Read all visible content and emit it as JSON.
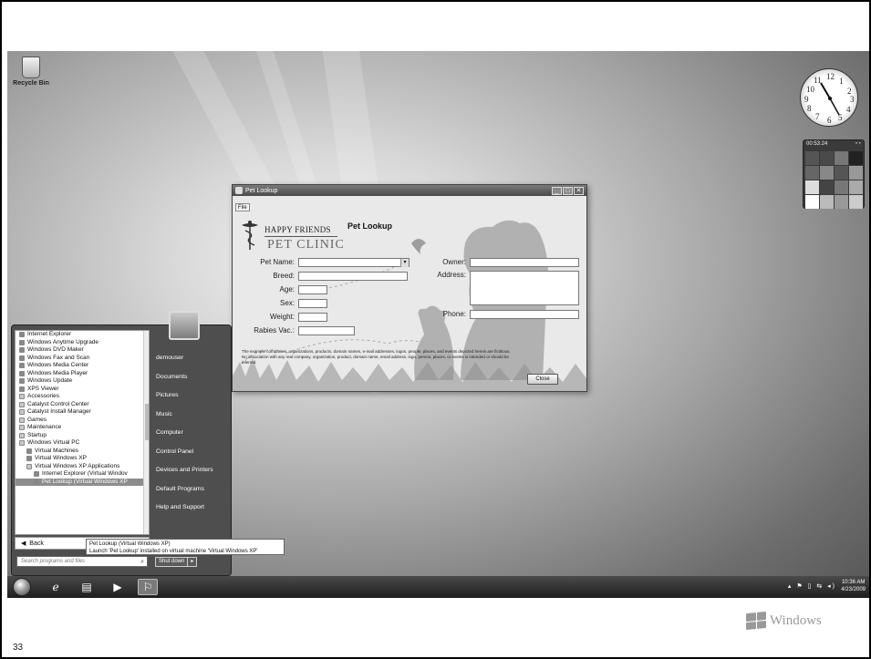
{
  "desktop": {
    "recycle_bin_label": "Recycle Bin",
    "clock_numbers": [
      "12",
      "1",
      "2",
      "3",
      "4",
      "5",
      "6",
      "7",
      "8",
      "9",
      "10",
      "11"
    ],
    "puzzle_timer": "00:53:24"
  },
  "window": {
    "title": "Pet Lookup",
    "menu_file": "File",
    "logo_line1": "HAPPY FRIENDS",
    "logo_line2": "PET CLINIC",
    "heading": "Pet Lookup",
    "labels": {
      "pet_name": "Pet Name:",
      "breed": "Breed:",
      "age": "Age:",
      "sex": "Sex:",
      "weight": "Weight:",
      "rabies": "Rabies Vac.:",
      "owner": "Owner:",
      "address": "Address:",
      "phone": "Phone:"
    },
    "disclaimer": "The example companies, organizations, products, domain names, e-mail addresses, logos, people, places, and events depicted herein are fictitious. No association with any real company, organization, product, domain name, email address, logo, person, places, or events is intended or should be inferred.",
    "close_label": "Close"
  },
  "start_menu": {
    "programs": [
      {
        "label": "Internet Explorer",
        "kind": "app"
      },
      {
        "label": "Windows Anytime Upgrade",
        "kind": "app"
      },
      {
        "label": "Windows DVD Maker",
        "kind": "app"
      },
      {
        "label": "Windows Fax and Scan",
        "kind": "app"
      },
      {
        "label": "Windows Media Center",
        "kind": "app"
      },
      {
        "label": "Windows Media Player",
        "kind": "app"
      },
      {
        "label": "Windows Update",
        "kind": "app"
      },
      {
        "label": "XPS Viewer",
        "kind": "app"
      },
      {
        "label": "Accessories",
        "kind": "folder"
      },
      {
        "label": "Catalyst Control Center",
        "kind": "folder"
      },
      {
        "label": "Catalyst Install Manager",
        "kind": "folder"
      },
      {
        "label": "Games",
        "kind": "folder"
      },
      {
        "label": "Maintenance",
        "kind": "folder"
      },
      {
        "label": "Startup",
        "kind": "folder"
      },
      {
        "label": "Windows Virtual PC",
        "kind": "folder"
      },
      {
        "label": "Virtual Machines",
        "kind": "app"
      },
      {
        "label": "Virtual Windows XP",
        "kind": "app"
      },
      {
        "label": "Virtual Windows XP Applications",
        "kind": "folder"
      },
      {
        "label": "Internet Explorer (Virtual Windov",
        "kind": "app"
      },
      {
        "label": "Pet Lookup (Virtual Windows XP",
        "kind": "app"
      }
    ],
    "back_label": "Back",
    "search_placeholder": "Search programs and files",
    "right_links": [
      "demouser",
      "Documents",
      "Pictures",
      "Music",
      "Computer",
      "Control Panel",
      "Devices and Printers",
      "Default Programs",
      "Help and Support"
    ],
    "shutdown_label": "Shut down"
  },
  "tooltip": {
    "line1": "Pet Lookup (Virtual Windows XP)",
    "line2": "Launch 'Pet Lookup' installed on virtual machine 'Virtual Windows XP'"
  },
  "taskbar": {
    "time": "10:36 AM",
    "date": "4/23/2009"
  },
  "slide": {
    "page_number": "33",
    "brand": "Windows"
  }
}
